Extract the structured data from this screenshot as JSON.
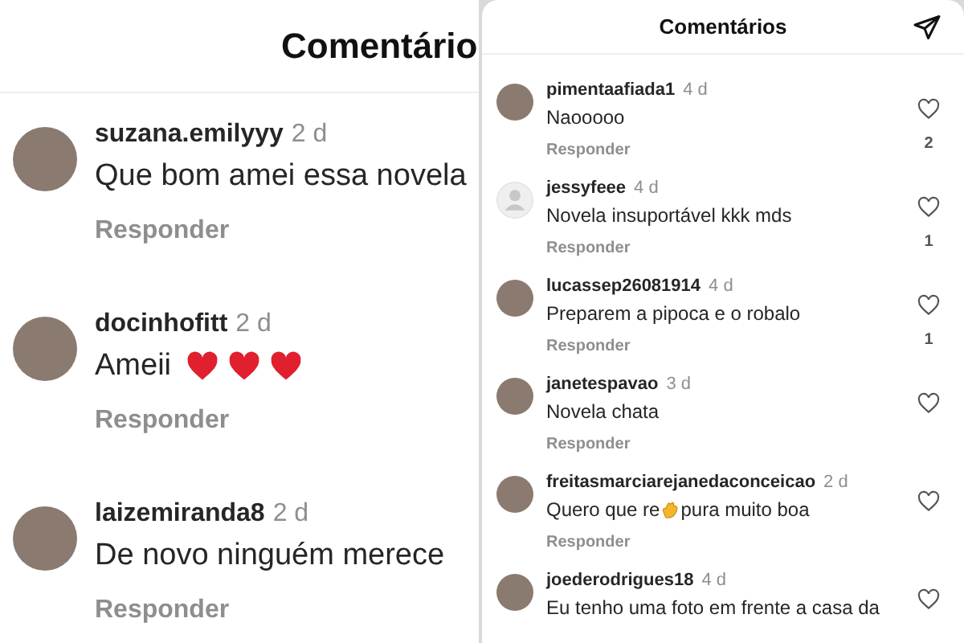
{
  "panels": [
    {
      "kind": "large",
      "title": "Comentário",
      "send_button": false,
      "comments": [
        {
          "avatar": {
            "kind": "photo"
          },
          "user": "suzana.emilyyy",
          "time": "2 d",
          "text": "Que bom amei essa novela",
          "reply": "Responder",
          "like_button": false
        },
        {
          "avatar": {
            "kind": "photo"
          },
          "user": "docinhofitt",
          "time": "2 d",
          "text": "Ameii",
          "emojis": [
            {
              "kind": "heart"
            },
            {
              "kind": "heart"
            },
            {
              "kind": "heart"
            }
          ],
          "reply": "Responder",
          "like_button": false
        },
        {
          "avatar": {
            "kind": "photo"
          },
          "user": "laizemiranda8",
          "time": "2 d",
          "text": "De novo ninguém merece",
          "reply": "Responder",
          "like_button": false
        }
      ]
    },
    {
      "kind": "small",
      "title": "Comentários",
      "send_button": true,
      "comments": [
        {
          "avatar": {
            "kind": "photo"
          },
          "user": "pimentaafiada1",
          "time": "4 d",
          "text": "Naooooo",
          "reply": "Responder",
          "like_button": true,
          "likes": "2"
        },
        {
          "avatar": {
            "kind": "default"
          },
          "user": "jessyfeee",
          "time": "4 d",
          "text": "Novela insuportável kkk mds",
          "reply": "Responder",
          "like_button": true,
          "likes": "1"
        },
        {
          "avatar": {
            "kind": "photo"
          },
          "user": "lucassep26081914",
          "time": "4 d",
          "text": "Preparem a pipoca e o robalo",
          "reply": "Responder",
          "like_button": true,
          "likes": "1"
        },
        {
          "avatar": {
            "kind": "photo"
          },
          "user": "janetespavao",
          "time": "3 d",
          "text": "Novela chata",
          "reply": "Responder",
          "like_button": true
        },
        {
          "avatar": {
            "kind": "photo"
          },
          "user": "freitasmarciarejanedaconceicao",
          "time": "2 d",
          "text": "Quero que re",
          "emojis": [
            {
              "kind": "clap"
            }
          ],
          "text_after": "pura muito boa",
          "reply": "Responder",
          "like_button": true
        },
        {
          "avatar": {
            "kind": "photo"
          },
          "user": "joederodrigues18",
          "time": "4 d",
          "text": "Eu tenho uma foto em frente a casa da",
          "like_button": true
        }
      ]
    }
  ]
}
